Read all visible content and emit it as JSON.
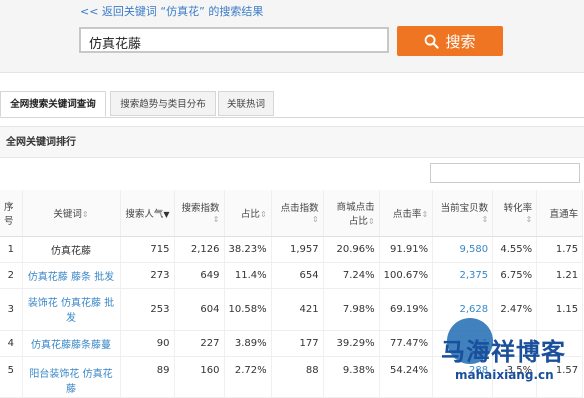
{
  "back_link": "<< 返回关键词 “仿真花” 的搜索结果",
  "search": {
    "value": "仿真花藤",
    "button": "搜索"
  },
  "tabs": [
    "全网搜索关键词查询",
    "搜索趋势与类目分布",
    "关联热词"
  ],
  "section_title": "全网关键词排行",
  "columns": [
    "序号",
    "关键词",
    "搜索人气",
    "搜索指数",
    "占比",
    "点击指数",
    "商城点击占比",
    "点击率",
    "当前宝贝数",
    "转化率",
    "直通车"
  ],
  "rows": [
    {
      "idx": "1",
      "kw": [
        "仿真花藤"
      ],
      "pop": "715",
      "sidx": "2,126",
      "ratio": "38.23%",
      "cidx": "1,957",
      "mall": "20.96%",
      "ctr": "91.91%",
      "items": "9,580",
      "conv": "4.55%",
      "ztc": "1.75"
    },
    {
      "idx": "2",
      "kw": [
        "仿真花藤 藤条 批发"
      ],
      "pop": "273",
      "sidx": "649",
      "ratio": "11.4%",
      "cidx": "654",
      "mall": "7.24%",
      "ctr": "100.67%",
      "items": "2,375",
      "conv": "6.75%",
      "ztc": "1.21"
    },
    {
      "idx": "3",
      "kw": [
        "装饰花 仿真花藤 批",
        "发"
      ],
      "pop": "253",
      "sidx": "604",
      "ratio": "10.58%",
      "cidx": "421",
      "mall": "7.98%",
      "ctr": "69.19%",
      "items": "2,628",
      "conv": "2.47%",
      "ztc": "1.15"
    },
    {
      "idx": "4",
      "kw": [
        "仿真花藤藤条藤蔓"
      ],
      "pop": "90",
      "sidx": "227",
      "ratio": "3.89%",
      "cidx": "177",
      "mall": "39.29%",
      "ctr": "77.47%",
      "items": "4,1",
      "conv": "",
      "ztc": ""
    },
    {
      "idx": "5",
      "kw": [
        "阳台装饰花 仿真花",
        "藤"
      ],
      "pop": "89",
      "sidx": "160",
      "ratio": "2.72%",
      "cidx": "88",
      "mall": "9.38%",
      "ctr": "54.24%",
      "items": "288",
      "conv": "3.5%",
      "ztc": "1.57"
    }
  ],
  "watermark": {
    "text": "马海祥博客",
    "url": "mahaixiang.cn"
  }
}
